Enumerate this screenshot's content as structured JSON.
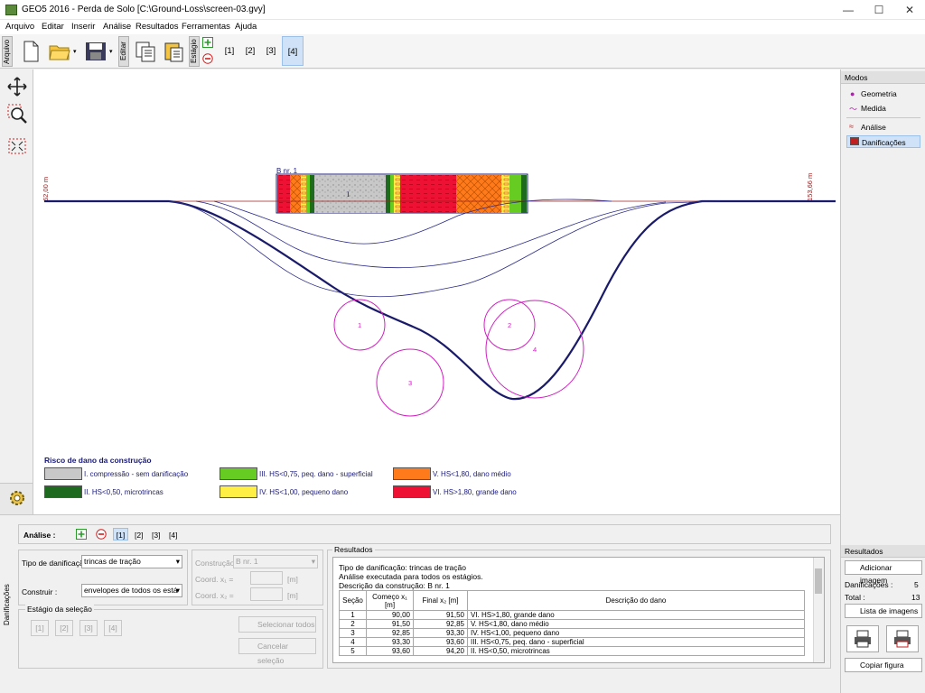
{
  "window": {
    "title": "GEO5 2016 - Perda de Solo [C:\\Ground-Loss\\screen-03.gvy]",
    "minimize": "—",
    "maximize": "☐",
    "close": "✕"
  },
  "menu": [
    "Arquivo",
    "Editar",
    "Inserir",
    "Análise",
    "Resultados",
    "Ferramentas",
    "Ajuda"
  ],
  "toolbar": {
    "arquivo_tab": "Arquivo",
    "editar_tab": "Editar",
    "estagio_tab": "Estágio",
    "stages": [
      "[1]",
      "[2]",
      "[3]",
      "[4]"
    ],
    "active_stage": "[4]"
  },
  "canvas": {
    "left_dim": "62,00 m",
    "right_dim": "153,66 m",
    "building_label": "B nr. 1",
    "zone_label": "I",
    "circles": [
      "1",
      "2",
      "3",
      "4"
    ],
    "legend_title": "Risco de dano da construção",
    "legend": [
      {
        "text": "I. compressão - sem danificação",
        "color": "#c8c8c8"
      },
      {
        "text": "II. HS<0,50, microtrincas",
        "color": "#1e6a1e"
      },
      {
        "text": "III. HS<0,75, peq. dano - superficial",
        "color": "#66cc22"
      },
      {
        "text": "IV. HS<1,00, pequeno dano",
        "color": "#ffee44"
      },
      {
        "text": "V. HS<1,80, dano médio",
        "color": "#ff7a1a"
      },
      {
        "text": "VI. HS>1,80, grande dano",
        "color": "#ee1133"
      }
    ]
  },
  "modes": {
    "title": "Modos",
    "items": [
      "Geometria",
      "Medida",
      "Análise",
      "Danificações"
    ],
    "active": "Danificações"
  },
  "results_panel": {
    "title": "Resultados",
    "add_image": "Adicionar imagem",
    "damages_label": "Danificações :",
    "damages_value": "5",
    "total_label": "Total :",
    "total_value": "13",
    "image_list": "Lista de imagens",
    "copy_figure": "Copiar figura"
  },
  "bottom": {
    "vtab": "Danificações",
    "analysis_label": "Análise :",
    "stages": [
      "[1]",
      "[2]",
      "[3]",
      "[4]"
    ],
    "active_stage": "[1]",
    "damage_type_label": "Tipo de danificação",
    "damage_type_value": "trincas de tração",
    "build_label": "Construir :",
    "build_value": "envelopes de todos os está",
    "construction_label": "Construção",
    "construction_value": "B nr. 1",
    "coord1_label": "Coord.  x₁ =",
    "coord2_label": "Coord.  x₂ =",
    "unit": "[m]",
    "selection_stage_title": "Estágio da seleção",
    "selection_stages": [
      "[1]",
      "[2]",
      "[3]",
      "[4]"
    ],
    "select_all": "Selecionar todos",
    "cancel_selection": "Cancelar seleção"
  },
  "results": {
    "title": "Resultados",
    "line1": "Tipo de danificação: trincas de tração",
    "line2": "Análise executada para todos os estágios.",
    "line3": "Descrição da construção: B nr. 1",
    "headers": [
      "Seção",
      "Começo x₁ [m]",
      "Final x₂ [m]",
      "Descrição do dano"
    ],
    "rows": [
      [
        "1",
        "90,00",
        "91,50",
        "VI. HS>1,80, grande dano"
      ],
      [
        "2",
        "91,50",
        "92,85",
        "V. HS<1,80, dano médio"
      ],
      [
        "3",
        "92,85",
        "93,30",
        "IV. HS<1,00, pequeno dano"
      ],
      [
        "4",
        "93,30",
        "93,60",
        "III. HS<0,75, peq. dano - superficial"
      ],
      [
        "5",
        "93,60",
        "94,20",
        "II. HS<0,50, microtrincas"
      ]
    ]
  }
}
